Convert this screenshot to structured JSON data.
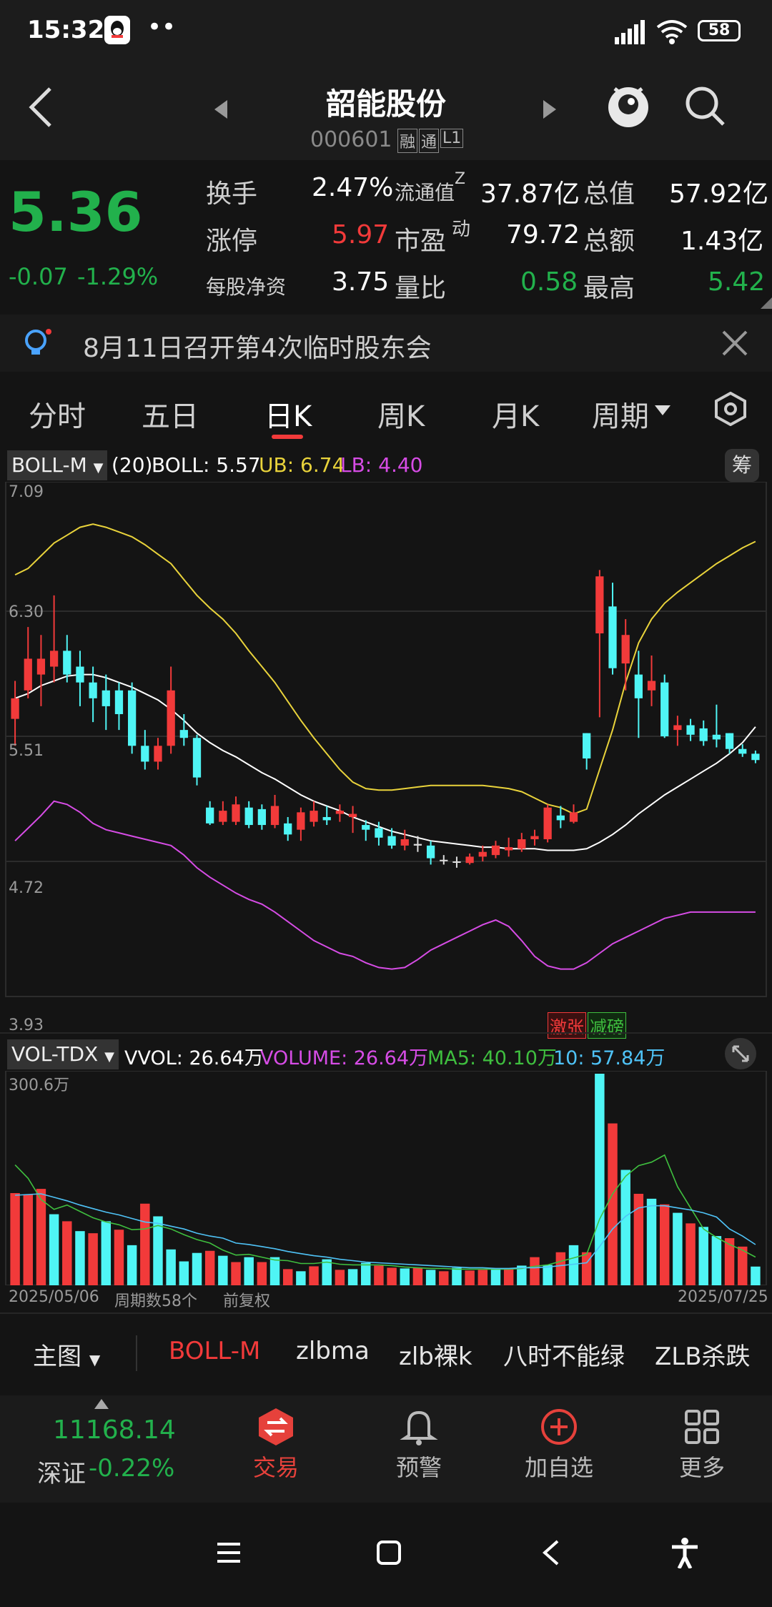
{
  "status_bar": {
    "time": "15:32",
    "dots": "••",
    "battery": "58"
  },
  "header": {
    "title": "韶能股份",
    "code": "000601",
    "tag_rong": "融",
    "tag_tong": "通",
    "tag_level": "L1"
  },
  "quote": {
    "price": "5.36",
    "change": "-0.07",
    "change_pct": "-1.29%",
    "rows": [
      [
        {
          "label": "换手",
          "value": "2.47%"
        },
        {
          "label": "流通值",
          "sup": "Z",
          "value": "37.87亿"
        },
        {
          "label": "总值",
          "value": "57.92亿"
        }
      ],
      [
        {
          "label": "涨停",
          "value": "5.97"
        },
        {
          "label": "市盈",
          "sup": "动",
          "value": "79.72"
        },
        {
          "label": "总额",
          "value": "1.43亿"
        }
      ],
      [
        {
          "label": "每股净资",
          "value": "3.75"
        },
        {
          "label": "量比",
          "value": "0.58"
        },
        {
          "label": "最高",
          "value": "5.42"
        }
      ]
    ]
  },
  "notice": {
    "text": "8月11日召开第4次临时股东会"
  },
  "tabs": [
    "分时",
    "五日",
    "日K",
    "周K",
    "月K",
    "周期"
  ],
  "boll_header": {
    "name": "BOLL-M",
    "params": "(20)",
    "boll": "BOLL: 5.57",
    "ub": "UB: 6.74",
    "lb": "LB: 4.40",
    "chip": "筹"
  },
  "price_axis": [
    "7.09",
    "6.30",
    "5.51",
    "4.72",
    "3.93"
  ],
  "chart_tags": {
    "jizhang": "激张",
    "jianpang": "减磅"
  },
  "vol_header": {
    "name": "VOL-TDX",
    "vvol": "VVOL: 26.64万",
    "volume": "VOLUME: 26.64万",
    "ma5": "MA5: 40.10万",
    "ma10": "10: 57.84万",
    "max": "300.6万"
  },
  "vol_footer": {
    "start_date": "2025/05/06",
    "period_count": "周期数58个",
    "adjust": "前复权",
    "end_date": "2025/07/25"
  },
  "indicator_bar": {
    "main_label": "主图",
    "items": [
      "BOLL-M",
      "zlbma",
      "zlb裸k",
      "八时不能绿",
      "ZLB杀跌"
    ]
  },
  "bottom_nav": {
    "index_value": "11168.14",
    "index_name": "深证",
    "index_change": "-0.22%",
    "items": [
      "交易",
      "预警",
      "加自选",
      "更多"
    ]
  },
  "chart_data": {
    "type": "candlestick",
    "title": "",
    "x_range": [
      "2025/05/06",
      "2025/07/25"
    ],
    "ylim": [
      3.93,
      7.09
    ],
    "candles": [
      [
        5.62,
        5.75,
        5.45,
        5.86
      ],
      [
        5.8,
        6.0,
        5.75,
        6.2
      ],
      [
        5.9,
        6.0,
        5.7,
        6.15
      ],
      [
        5.95,
        6.05,
        5.85,
        6.4
      ],
      [
        6.05,
        5.9,
        5.85,
        6.15
      ],
      [
        5.95,
        5.85,
        5.7,
        6.05
      ],
      [
        5.85,
        5.75,
        5.6,
        5.95
      ],
      [
        5.8,
        5.7,
        5.55,
        5.9
      ],
      [
        5.8,
        5.65,
        5.55,
        5.85
      ],
      [
        5.8,
        5.45,
        5.4,
        5.85
      ],
      [
        5.45,
        5.35,
        5.3,
        5.55
      ],
      [
        5.35,
        5.45,
        5.3,
        5.5
      ],
      [
        5.45,
        5.8,
        5.4,
        5.95
      ],
      [
        5.55,
        5.5,
        5.45,
        5.65
      ],
      [
        5.5,
        5.25,
        5.2,
        5.52
      ],
      [
        5.06,
        4.96,
        4.95,
        5.1
      ],
      [
        4.97,
        5.04,
        4.95,
        5.1
      ],
      [
        4.97,
        5.08,
        4.95,
        5.13
      ],
      [
        5.06,
        4.95,
        4.93,
        5.1
      ],
      [
        5.05,
        4.95,
        4.92,
        5.08
      ],
      [
        4.95,
        5.07,
        4.93,
        5.14
      ],
      [
        4.96,
        4.89,
        4.85,
        5.0
      ],
      [
        4.92,
        5.03,
        4.85,
        5.06
      ],
      [
        4.97,
        5.04,
        4.94,
        5.1
      ],
      [
        5.0,
        4.98,
        4.95,
        5.07
      ],
      [
        5.02,
        5.04,
        4.97,
        5.08
      ],
      [
        5.0,
        5.02,
        4.9,
        5.07
      ],
      [
        4.95,
        4.92,
        4.85,
        4.98
      ],
      [
        4.93,
        4.87,
        4.82,
        4.97
      ],
      [
        4.88,
        4.82,
        4.8,
        4.93
      ],
      [
        4.82,
        4.86,
        4.79,
        4.92
      ],
      [
        4.83,
        4.82,
        4.78,
        4.88
      ],
      [
        4.82,
        4.74,
        4.7,
        4.85
      ],
      [
        4.73,
        4.73,
        4.7,
        4.76
      ],
      [
        4.72,
        4.72,
        4.68,
        4.75
      ],
      [
        4.71,
        4.75,
        4.7,
        4.77
      ],
      [
        4.75,
        4.78,
        4.72,
        4.82
      ],
      [
        4.76,
        4.82,
        4.74,
        4.85
      ],
      [
        4.79,
        4.81,
        4.75,
        4.87
      ],
      [
        4.8,
        4.86,
        4.78,
        4.9
      ],
      [
        4.86,
        4.88,
        4.82,
        4.92
      ],
      [
        4.86,
        5.06,
        4.84,
        5.08
      ],
      [
        5.01,
        4.98,
        4.93,
        5.07
      ],
      [
        4.97,
        5.03,
        4.96,
        5.08
      ],
      [
        5.53,
        5.37,
        5.3,
        5.53
      ],
      [
        6.16,
        6.52,
        5.63,
        6.56
      ],
      [
        6.33,
        5.94,
        5.9,
        6.48
      ],
      [
        5.97,
        6.15,
        5.8,
        6.25
      ],
      [
        5.9,
        5.75,
        5.5,
        6.05
      ],
      [
        5.8,
        5.86,
        5.7,
        6.02
      ],
      [
        5.85,
        5.51,
        5.5,
        5.9
      ],
      [
        5.55,
        5.58,
        5.45,
        5.64
      ],
      [
        5.58,
        5.52,
        5.48,
        5.62
      ],
      [
        5.56,
        5.48,
        5.45,
        5.61
      ],
      [
        5.52,
        5.49,
        5.44,
        5.71
      ],
      [
        5.53,
        5.43,
        5.4,
        5.53
      ],
      [
        5.43,
        5.4,
        5.38,
        5.46
      ],
      [
        5.4,
        5.36,
        5.34,
        5.42
      ]
    ],
    "boll": [
      5.75,
      5.78,
      5.83,
      5.86,
      5.89,
      5.9,
      5.9,
      5.88,
      5.85,
      5.82,
      5.78,
      5.74,
      5.68,
      5.61,
      5.53,
      5.47,
      5.42,
      5.38,
      5.33,
      5.28,
      5.24,
      5.19,
      5.14,
      5.1,
      5.07,
      5.04,
      5.0,
      4.97,
      4.94,
      4.91,
      4.89,
      4.87,
      4.85,
      4.84,
      4.83,
      4.82,
      4.81,
      4.81,
      4.8,
      4.8,
      4.8,
      4.79,
      4.79,
      4.79,
      4.8,
      4.84,
      4.89,
      4.95,
      5.02,
      5.08,
      5.14,
      5.19,
      5.24,
      5.29,
      5.34,
      5.4,
      5.47,
      5.57
    ],
    "ub": [
      6.53,
      6.57,
      6.65,
      6.73,
      6.78,
      6.83,
      6.85,
      6.83,
      6.8,
      6.77,
      6.72,
      6.66,
      6.6,
      6.5,
      6.4,
      6.32,
      6.25,
      6.16,
      6.05,
      5.95,
      5.85,
      5.73,
      5.61,
      5.5,
      5.4,
      5.3,
      5.22,
      5.18,
      5.17,
      5.17,
      5.18,
      5.19,
      5.2,
      5.2,
      5.2,
      5.2,
      5.2,
      5.19,
      5.18,
      5.16,
      5.12,
      5.08,
      5.06,
      5.02,
      5.05,
      5.3,
      5.55,
      5.85,
      6.1,
      6.25,
      6.35,
      6.42,
      6.48,
      6.54,
      6.6,
      6.65,
      6.7,
      6.74
    ],
    "lb": [
      4.85,
      4.93,
      5.01,
      5.1,
      5.08,
      5.03,
      4.96,
      4.92,
      4.9,
      4.88,
      4.86,
      4.84,
      4.82,
      4.76,
      4.68,
      4.62,
      4.57,
      4.52,
      4.48,
      4.45,
      4.4,
      4.34,
      4.28,
      4.22,
      4.18,
      4.14,
      4.12,
      4.08,
      4.05,
      4.04,
      4.05,
      4.1,
      4.16,
      4.2,
      4.24,
      4.28,
      4.32,
      4.35,
      4.31,
      4.22,
      4.12,
      4.06,
      4.04,
      4.04,
      4.08,
      4.14,
      4.2,
      4.24,
      4.28,
      4.32,
      4.36,
      4.38,
      4.4,
      4.4,
      4.4,
      4.4,
      4.4,
      4.4
    ],
    "volume_ylim": [
      0,
      300.6
    ],
    "volume": [
      131,
      129,
      137,
      101,
      91,
      77,
      74,
      91,
      79,
      57,
      116,
      98,
      51,
      34,
      46,
      49,
      42,
      33,
      40,
      33,
      40,
      23,
      20,
      27,
      37,
      22,
      23,
      32,
      28,
      25,
      24,
      25,
      22,
      20,
      25,
      21,
      22,
      23,
      24,
      28,
      40,
      29,
      47,
      57,
      47,
      300.6,
      230,
      164,
      130,
      123,
      115,
      103,
      88,
      83,
      70,
      67,
      55,
      26.64
    ],
    "vol_up": [
      1,
      1,
      1,
      0,
      1,
      0,
      1,
      0,
      1,
      0,
      1,
      0,
      0,
      0,
      0,
      1,
      0,
      1,
      0,
      1,
      0,
      1,
      0,
      1,
      0,
      1,
      0,
      0,
      1,
      1,
      0,
      1,
      0,
      1,
      0,
      1,
      1,
      0,
      1,
      0,
      1,
      0,
      1,
      0,
      1,
      0,
      1,
      0,
      1,
      0,
      1,
      0,
      1,
      0,
      0,
      1,
      1,
      0
    ],
    "ma5": [
      171,
      152,
      122,
      108,
      114,
      105,
      96,
      90,
      86,
      79,
      80,
      85,
      80,
      72,
      65,
      60,
      50,
      43,
      44,
      40,
      36,
      35,
      31,
      31,
      33,
      30,
      29,
      29,
      29,
      28,
      26,
      25,
      24,
      24,
      23,
      23,
      23,
      23,
      23,
      24,
      27,
      29,
      34,
      39,
      44,
      94,
      130,
      155,
      170,
      175,
      185,
      140,
      110,
      80,
      68,
      58,
      50,
      40.1
    ],
    "ma10": [
      128,
      129,
      130,
      125,
      120,
      114,
      109,
      104,
      100,
      95,
      90,
      88,
      84,
      80,
      74,
      70,
      67,
      60,
      58,
      55,
      52,
      48,
      45,
      42,
      40,
      37,
      35,
      33,
      32,
      31,
      30,
      29,
      28,
      27,
      26,
      25,
      25,
      24,
      24,
      25,
      25,
      26,
      28,
      30,
      32,
      55,
      80,
      98,
      110,
      113,
      113,
      110,
      107,
      103,
      97,
      80,
      70,
      57.84
    ]
  }
}
